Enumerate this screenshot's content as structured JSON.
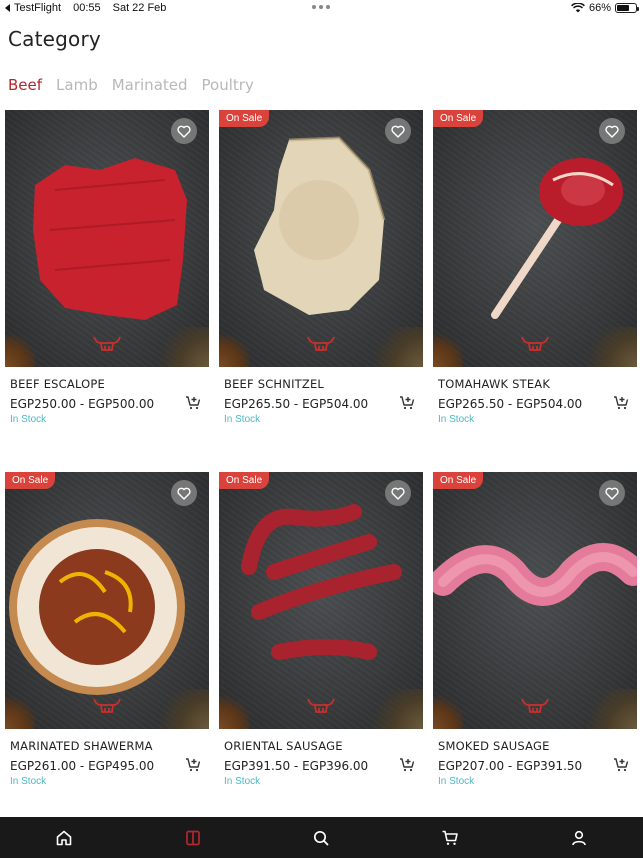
{
  "status_bar": {
    "back_app": "TestFlight",
    "time": "00:55",
    "date": "Sat 22 Feb",
    "battery": "66%",
    "battery_level": 0.66
  },
  "page": {
    "title": "Category"
  },
  "tabs": [
    {
      "label": "Beef",
      "active": true
    },
    {
      "label": "Lamb",
      "active": false
    },
    {
      "label": "Marinated",
      "active": false
    },
    {
      "label": "Poultry",
      "active": false
    }
  ],
  "products": [
    {
      "name": "BEEF ESCALOPE",
      "price": "EGP250.00 - EGP500.00",
      "stock": "In Stock",
      "on_sale": false,
      "image": "beef-escalope-photo"
    },
    {
      "name": "BEEF SCHNITZEL",
      "price": "EGP265.50 - EGP504.00",
      "stock": "In Stock",
      "on_sale": true,
      "sale_label": "On Sale",
      "image": "beef-schnitzel-photo"
    },
    {
      "name": "TOMAHAWK STEAK",
      "price": "EGP265.50 - EGP504.00",
      "stock": "In Stock",
      "on_sale": true,
      "sale_label": "On Sale",
      "image": "tomahawk-steak-photo"
    },
    {
      "name": "MARINATED SHAWERMA",
      "price": "EGP261.00 - EGP495.00",
      "stock": "In Stock",
      "on_sale": true,
      "sale_label": "On Sale",
      "image": "shawerma-plate-photo"
    },
    {
      "name": "ORIENTAL SAUSAGE",
      "price": "EGP391.50 - EGP396.00",
      "stock": "In Stock",
      "on_sale": true,
      "sale_label": "On Sale",
      "image": "oriental-sausage-photo"
    },
    {
      "name": "SMOKED SAUSAGE",
      "price": "EGP207.00 - EGP391.50",
      "stock": "In Stock",
      "on_sale": true,
      "sale_label": "On Sale",
      "image": "smoked-sausage-photo"
    }
  ],
  "bottom_nav": [
    {
      "icon": "home-icon",
      "active": false
    },
    {
      "icon": "categories-icon",
      "active": true
    },
    {
      "icon": "search-icon",
      "active": false
    },
    {
      "icon": "cart-icon",
      "active": false
    },
    {
      "icon": "account-icon",
      "active": false
    }
  ],
  "colors": {
    "accent": "#b3272d",
    "sale_badge": "#d9433b",
    "in_stock": "#4bb8c4",
    "nav_bg": "#191919",
    "inactive_tab": "#b8b8b8"
  }
}
